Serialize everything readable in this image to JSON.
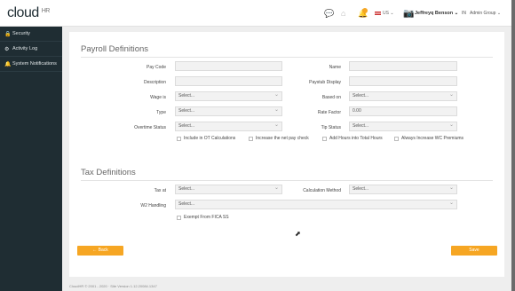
{
  "header": {
    "logo_text": "cloud",
    "logo_suffix": "HR",
    "notification_count": "0",
    "language": "US",
    "user_name": "Jeffreyq Benson",
    "in_label": "IN",
    "group_label": "Admin Group"
  },
  "sidebar": {
    "items": [
      {
        "label": "Security",
        "icon": "lock-icon"
      },
      {
        "label": "Activity Log",
        "icon": "gears-icon"
      },
      {
        "label": "System Notifications",
        "icon": "bell-icon"
      }
    ]
  },
  "payroll": {
    "title": "Payroll Definitions",
    "pay_code_label": "Pay Code",
    "pay_code_value": "",
    "name_label": "Name",
    "name_value": "",
    "description_label": "Description",
    "description_value": "",
    "paystub_display_label": "Paystub Display",
    "paystub_display_value": "",
    "wage_is_label": "Wage is",
    "wage_is_value": "Select...",
    "based_on_label": "Based on",
    "based_on_value": "Select...",
    "type_label": "Type",
    "type_value": "Select...",
    "rate_factor_label": "Rate Factor",
    "rate_factor_value": "0.00",
    "overtime_status_label": "Overtime Status",
    "overtime_status_value": "Select...",
    "tip_status_label": "Tip Status",
    "tip_status_value": "Select...",
    "checkboxes": [
      "Include in OT Calculations",
      "Increase the net pay check",
      "Add Hours into Total Hours",
      "Always Increase WC Premiums"
    ]
  },
  "tax": {
    "title": "Tax Definitions",
    "tax_at_label": "Tax at",
    "tax_at_value": "Select...",
    "calc_method_label": "Calculation Method",
    "calc_method_value": "Select...",
    "w2_handling_label": "W2 Handling",
    "w2_handling_value": "Select...",
    "exempt_label": "Exempt From FICA SS"
  },
  "actions": {
    "back_label": "← Back",
    "save_label": "Save"
  },
  "footer_text": "CloudHR © 2001 - 2020 · Site Version 1.12.20084.1347"
}
